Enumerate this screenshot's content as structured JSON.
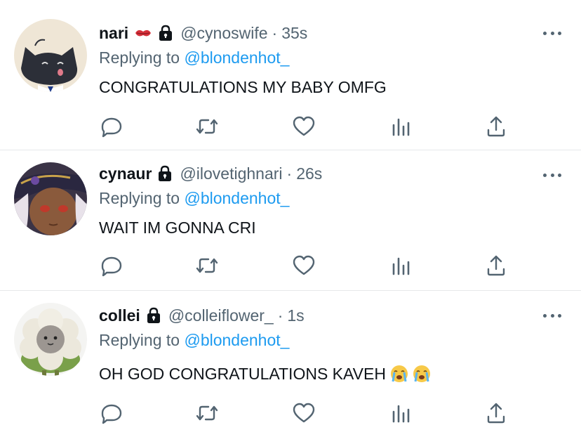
{
  "tweets": [
    {
      "name": "nari",
      "name_emoji": "kiss-mark",
      "handle": "@cynoswife",
      "time": "35s",
      "replying_prefix": "Replying to",
      "replying_to": "@blondenhot_",
      "text": "CONGRATULATIONS MY BABY OMFG"
    },
    {
      "name": "cynaur",
      "handle": "@ilovetighnari",
      "time": "26s",
      "replying_prefix": "Replying to",
      "replying_to": "@blondenhot_",
      "text": "WAIT IM GONNA CRI"
    },
    {
      "name": "collei",
      "handle": "@colleiflower_",
      "time": "1s",
      "replying_prefix": "Replying to",
      "replying_to": "@blondenhot_",
      "text": "OH GOD CONGRATULATIONS KAVEH",
      "text_emojis": [
        "loudly-crying-face",
        "loudly-crying-face"
      ]
    }
  ],
  "separator": "·",
  "icons": [
    "reply-icon",
    "retweet-icon",
    "like-icon",
    "analytics-icon",
    "share-icon",
    "more-icon",
    "lock-icon"
  ],
  "colors": {
    "link": "#1d9bf0",
    "muted": "#536471",
    "text": "#0f1419",
    "divider": "#e6e8ea"
  }
}
